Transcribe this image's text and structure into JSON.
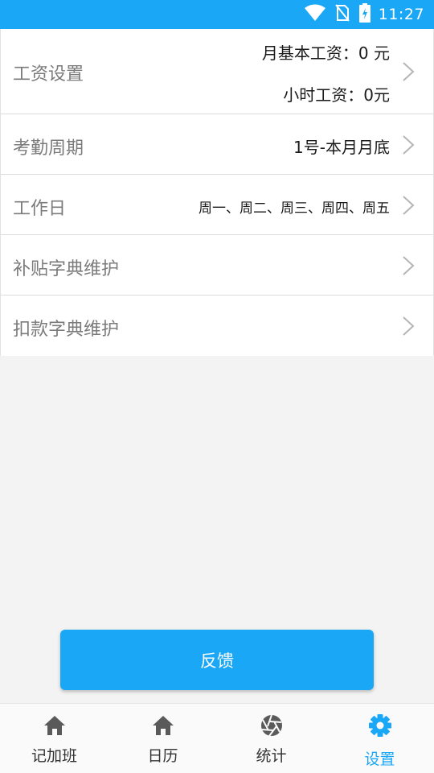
{
  "status_bar": {
    "time": "11:27",
    "icons": [
      "wifi-icon",
      "no-sim-icon",
      "battery-charging-icon"
    ]
  },
  "settings": {
    "salary": {
      "title": "工资设置",
      "monthly_base": "月基本工资：0 元",
      "hourly": "小时工资：0元"
    },
    "attendance_cycle": {
      "title": "考勤周期",
      "value": "1号-本月月底"
    },
    "workdays": {
      "title": "工作日",
      "value": "周一、周二、周三、周四、周五"
    },
    "allowance_dict": {
      "title": "补贴字典维护"
    },
    "deduction_dict": {
      "title": "扣款字典维护"
    }
  },
  "feedback_label": "反馈",
  "bottom_nav": {
    "items": [
      {
        "label": "记加班",
        "icon": "home-icon"
      },
      {
        "label": "日历",
        "icon": "home-icon"
      },
      {
        "label": "统计",
        "icon": "aperture-icon"
      },
      {
        "label": "设置",
        "icon": "gear-icon",
        "active": true
      }
    ]
  },
  "colors": {
    "accent": "#1aa7f5",
    "background": "#f3f3f3",
    "row_title": "#7b7b7b"
  }
}
